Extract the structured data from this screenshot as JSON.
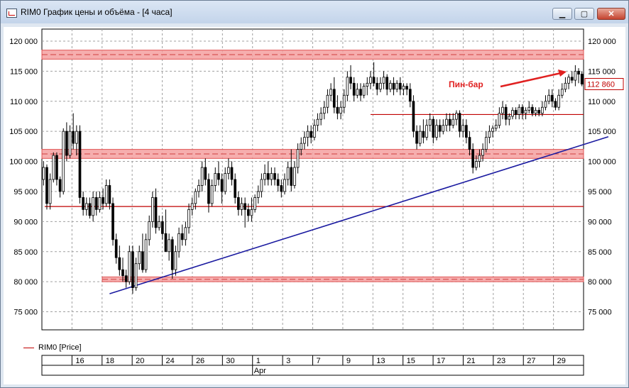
{
  "window": {
    "title": "RIM0 График цены и объёма - [4 часа]",
    "buttons": {
      "minimize": "▁",
      "maximize": "▢",
      "close": "✕"
    }
  },
  "legend": {
    "label": "RIM0 [Price]",
    "color": "#c00000"
  },
  "annotation": {
    "text": "Пин-бар",
    "color": "#e02020"
  },
  "last_price_label": "112 860",
  "chart_data": {
    "type": "candlestick",
    "symbol": "RIM0",
    "timeframe": "4 часа",
    "ylim": [
      72000,
      122000
    ],
    "y_ticks": [
      75000,
      80000,
      85000,
      90000,
      95000,
      100000,
      105000,
      110000,
      115000,
      120000
    ],
    "y_tick_labels": [
      "75 000",
      "80 000",
      "85 000",
      "90 000",
      "95 000",
      "100 000",
      "105 000",
      "110 000",
      "115 000",
      "120 000"
    ],
    "x_date_labels": [
      "16",
      "18",
      "20",
      "24",
      "26",
      "30",
      "1",
      "3",
      "7",
      "9",
      "13",
      "15",
      "17",
      "21",
      "23",
      "27",
      "29"
    ],
    "month_label": "Apr",
    "grid": true,
    "resistance_zones": [
      [
        117000,
        118500
      ],
      [
        100500,
        102000
      ],
      [
        80000,
        80800
      ]
    ],
    "horizontal_levels": [
      107800,
      92500
    ],
    "trendline": {
      "start": {
        "bar": 20,
        "price": 78000
      },
      "end": {
        "bar": 171,
        "price": 104100
      }
    },
    "candles": [
      [
        97000,
        100000,
        96000,
        99000
      ],
      [
        99000,
        99500,
        92000,
        93000
      ],
      [
        93000,
        98000,
        92000,
        97000
      ],
      [
        97000,
        101500,
        96500,
        101000
      ],
      [
        101000,
        101500,
        96000,
        97000
      ],
      [
        97000,
        97500,
        94000,
        95000
      ],
      [
        95000,
        105500,
        94500,
        105000
      ],
      [
        105000,
        106500,
        100000,
        101000
      ],
      [
        101000,
        106000,
        100500,
        105000
      ],
      [
        105000,
        108000,
        102000,
        103000
      ],
      [
        103000,
        106000,
        101000,
        105000
      ],
      [
        105000,
        106000,
        93000,
        94000
      ],
      [
        94000,
        95000,
        91000,
        92000
      ],
      [
        92000,
        94000,
        91000,
        93000
      ],
      [
        93000,
        94000,
        90500,
        91000
      ],
      [
        91000,
        95000,
        90000,
        94000
      ],
      [
        94000,
        95000,
        91000,
        92000
      ],
      [
        92000,
        95000,
        91500,
        94000
      ],
      [
        94000,
        95500,
        92000,
        93000
      ],
      [
        93000,
        97000,
        92500,
        96000
      ],
      [
        96000,
        97000,
        92000,
        93000
      ],
      [
        93000,
        94000,
        86000,
        87000
      ],
      [
        87000,
        88000,
        83000,
        84000
      ],
      [
        84000,
        86000,
        81000,
        82000
      ],
      [
        82000,
        84000,
        80000,
        81000
      ],
      [
        81000,
        82000,
        79000,
        80000
      ],
      [
        80000,
        86000,
        79500,
        85000
      ],
      [
        85000,
        86000,
        78000,
        79000
      ],
      [
        79000,
        84000,
        78500,
        83000
      ],
      [
        83000,
        86000,
        82000,
        85000
      ],
      [
        85000,
        88000,
        81500,
        82000
      ],
      [
        82000,
        88000,
        81500,
        87000
      ],
      [
        87000,
        91000,
        86000,
        90000
      ],
      [
        90000,
        95000,
        89000,
        94000
      ],
      [
        94000,
        95500,
        88000,
        89000
      ],
      [
        89000,
        91000,
        88500,
        90000
      ],
      [
        90000,
        91000,
        87000,
        88000
      ],
      [
        88000,
        92000,
        86000,
        85000
      ],
      [
        85000,
        88000,
        83500,
        87000
      ],
      [
        87000,
        87500,
        80500,
        82000
      ],
      [
        82000,
        86000,
        81000,
        85000
      ],
      [
        85000,
        89000,
        84000,
        88000
      ],
      [
        88000,
        89500,
        86000,
        87000
      ],
      [
        87000,
        90000,
        86000,
        89000
      ],
      [
        89000,
        93000,
        88000,
        92000
      ],
      [
        92000,
        94000,
        91000,
        93000
      ],
      [
        93000,
        95500,
        92000,
        95000
      ],
      [
        95000,
        97000,
        94000,
        96000
      ],
      [
        96000,
        100000,
        95000,
        99000
      ],
      [
        99000,
        100500,
        96000,
        97000
      ],
      [
        97000,
        98000,
        91500,
        93000
      ],
      [
        93000,
        97000,
        92500,
        96000
      ],
      [
        96000,
        99000,
        95000,
        98000
      ],
      [
        98000,
        100000,
        96000,
        97000
      ],
      [
        97000,
        98000,
        93000,
        95000
      ],
      [
        95000,
        99000,
        94500,
        98000
      ],
      [
        98000,
        100500,
        97000,
        99000
      ],
      [
        99000,
        100000,
        96000,
        97000
      ],
      [
        97000,
        98000,
        93000,
        94000
      ],
      [
        94000,
        95000,
        91000,
        92000
      ],
      [
        92000,
        94000,
        91000,
        93000
      ],
      [
        93000,
        94000,
        89000,
        92000
      ],
      [
        92000,
        93000,
        90000,
        91000
      ],
      [
        91000,
        94000,
        90000,
        92000
      ],
      [
        92000,
        94500,
        91500,
        94000
      ],
      [
        94000,
        96000,
        93000,
        95000
      ],
      [
        95000,
        98000,
        94000,
        97000
      ],
      [
        97000,
        99500,
        96000,
        98000
      ],
      [
        98000,
        100000,
        96000,
        97000
      ],
      [
        97000,
        99000,
        96000,
        98000
      ],
      [
        98000,
        99000,
        96000,
        97000
      ],
      [
        97000,
        98000,
        95000,
        96000
      ],
      [
        96000,
        97000,
        94000,
        95000
      ],
      [
        95000,
        98000,
        94500,
        97000
      ],
      [
        97000,
        100000,
        96000,
        99000
      ],
      [
        99000,
        102000,
        95000,
        96000
      ],
      [
        96000,
        100000,
        95500,
        99000
      ],
      [
        99000,
        103000,
        98000,
        102000
      ],
      [
        102000,
        104000,
        101000,
        103000
      ],
      [
        103000,
        105000,
        102000,
        104000
      ],
      [
        104000,
        106000,
        102500,
        105000
      ],
      [
        105000,
        106000,
        103000,
        104000
      ],
      [
        104000,
        107000,
        103500,
        106000
      ],
      [
        106000,
        108000,
        105000,
        107000
      ],
      [
        107000,
        109000,
        106000,
        108000
      ],
      [
        108000,
        110000,
        107000,
        109000
      ],
      [
        109000,
        112000,
        108000,
        111000
      ],
      [
        111000,
        113000,
        110000,
        112000
      ],
      [
        112000,
        114000,
        108000,
        109000
      ],
      [
        109000,
        111000,
        107000,
        108000
      ],
      [
        108000,
        110000,
        107000,
        109000
      ],
      [
        109000,
        112000,
        108000,
        111000
      ],
      [
        111000,
        115000,
        110000,
        114000
      ],
      [
        114000,
        116000,
        112000,
        113000
      ],
      [
        113000,
        114000,
        110000,
        111000
      ],
      [
        111000,
        113000,
        110500,
        112000
      ],
      [
        112000,
        113000,
        110000,
        111000
      ],
      [
        111000,
        113000,
        110500,
        112500
      ],
      [
        112500,
        114000,
        111000,
        113000
      ],
      [
        113000,
        115000,
        112000,
        114000
      ],
      [
        114000,
        116500,
        112500,
        113000
      ],
      [
        113000,
        114000,
        111000,
        112000
      ],
      [
        112000,
        114000,
        111500,
        113000
      ],
      [
        113000,
        115000,
        112000,
        114000
      ],
      [
        114000,
        114500,
        111000,
        112000
      ],
      [
        112000,
        113500,
        111500,
        113000
      ],
      [
        113000,
        114000,
        111000,
        112000
      ],
      [
        112000,
        113500,
        111500,
        113000
      ],
      [
        113000,
        114000,
        111000,
        112000
      ],
      [
        112000,
        113000,
        111000,
        112500
      ],
      [
        112500,
        113000,
        111000,
        112000
      ],
      [
        112000,
        113000,
        109000,
        110000
      ],
      [
        110000,
        111000,
        104000,
        105000
      ],
      [
        105000,
        106000,
        102000,
        103000
      ],
      [
        103000,
        106000,
        102500,
        105000
      ],
      [
        105000,
        107000,
        103000,
        104000
      ],
      [
        104000,
        107000,
        103500,
        106000
      ],
      [
        106000,
        108000,
        105000,
        107000
      ],
      [
        107000,
        107500,
        103000,
        104000
      ],
      [
        104000,
        107000,
        103500,
        106000
      ],
      [
        106000,
        107000,
        104000,
        105000
      ],
      [
        105000,
        107000,
        104500,
        106000
      ],
      [
        106000,
        108000,
        105000,
        107000
      ],
      [
        107000,
        108000,
        105000,
        106000
      ],
      [
        106000,
        108000,
        105500,
        107000
      ],
      [
        107000,
        108500,
        106000,
        108000
      ],
      [
        108000,
        108500,
        104000,
        105000
      ],
      [
        105000,
        107000,
        104000,
        106000
      ],
      [
        106000,
        107000,
        103000,
        104000
      ],
      [
        104000,
        105000,
        101000,
        102000
      ],
      [
        102000,
        103000,
        98000,
        99000
      ],
      [
        99000,
        101000,
        98500,
        100000
      ],
      [
        100000,
        102000,
        99000,
        101000
      ],
      [
        101000,
        103000,
        100000,
        102000
      ],
      [
        102000,
        105000,
        101500,
        104000
      ],
      [
        104000,
        106000,
        103000,
        105000
      ],
      [
        105000,
        106000,
        104000,
        105500
      ],
      [
        105500,
        107000,
        105000,
        106000
      ],
      [
        106000,
        109000,
        105500,
        108000
      ],
      [
        108000,
        110000,
        107000,
        109000
      ],
      [
        109000,
        109500,
        106000,
        107000
      ],
      [
        107000,
        108000,
        106000,
        107500
      ],
      [
        107500,
        109000,
        107000,
        108500
      ],
      [
        108500,
        109000,
        107000,
        107800
      ],
      [
        107800,
        109500,
        107000,
        109000
      ],
      [
        109000,
        109500,
        107000,
        108000
      ],
      [
        108000,
        109000,
        107000,
        108500
      ],
      [
        108500,
        110000,
        108000,
        109000
      ],
      [
        109000,
        109500,
        107500,
        108000
      ],
      [
        108000,
        109000,
        107500,
        108500
      ],
      [
        108500,
        109000,
        107500,
        108000
      ],
      [
        108000,
        110000,
        107500,
        109000
      ],
      [
        109000,
        111000,
        108500,
        110000
      ],
      [
        110000,
        112000,
        109500,
        111000
      ],
      [
        111000,
        112000,
        109000,
        110000
      ],
      [
        110000,
        110500,
        108500,
        109000
      ],
      [
        109000,
        112000,
        108500,
        111000
      ],
      [
        111000,
        113000,
        110500,
        112000
      ],
      [
        112000,
        114000,
        111500,
        113000
      ],
      [
        113000,
        114500,
        112000,
        114000
      ],
      [
        114000,
        115000,
        113000,
        113500
      ],
      [
        113500,
        116000,
        112500,
        115000
      ],
      [
        115000,
        115500,
        113000,
        114500
      ],
      [
        114500,
        115000,
        112500,
        112860
      ]
    ]
  }
}
